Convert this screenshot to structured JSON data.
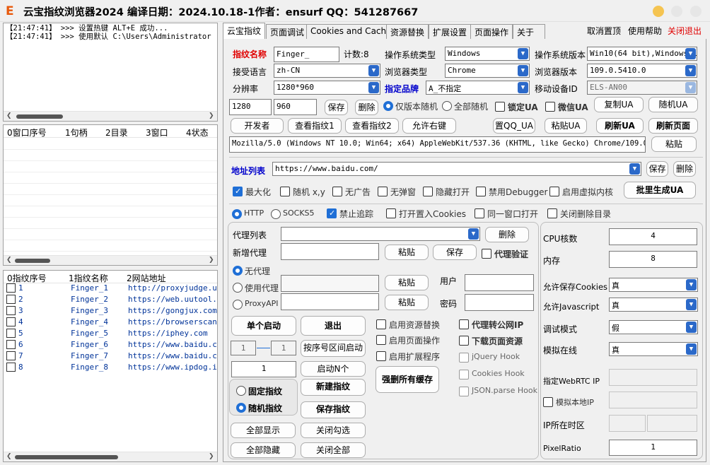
{
  "title": {
    "logo": "E",
    "text": "云宝指纹浏览器2024  编译日期：2024.10.18-1作者：ensurf  QQ：541287667"
  },
  "log": {
    "lines": [
      "【21:47:41】 >>> 设置热键 ALT+E 成功...",
      "【21:47:41】 >>> 使用默认 C:\\Users\\Administrator"
    ]
  },
  "windows_list": {
    "headers": [
      "0窗口序号",
      "1句柄",
      "2目录",
      "3窗口",
      "4状态"
    ]
  },
  "fingerprint_list": {
    "headers": [
      "0指纹序号",
      "1指纹名称",
      "2网站地址"
    ],
    "rows": [
      {
        "id": "1",
        "name": "Finger_1",
        "url": "http://proxyjudge.us"
      },
      {
        "id": "2",
        "name": "Finger_2",
        "url": "https://web.uutool.cn"
      },
      {
        "id": "3",
        "name": "Finger_3",
        "url": "https://gongjux.com/f"
      },
      {
        "id": "4",
        "name": "Finger_4",
        "url": "https://browserscan.n"
      },
      {
        "id": "5",
        "name": "Finger_5",
        "url": "https://iphey.com"
      },
      {
        "id": "6",
        "name": "Finger_6",
        "url": "https://www.baidu.com"
      },
      {
        "id": "7",
        "name": "Finger_7",
        "url": "https://www.baidu.com"
      },
      {
        "id": "8",
        "name": "Finger_8",
        "url": "https://www.ipdog.io/"
      }
    ]
  },
  "tabs": [
    "云宝指纹",
    "页面调试",
    "Cookies and Cache",
    "资源替换",
    "扩展设置",
    "页面操作",
    "关于"
  ],
  "menu": {
    "cancel_top": "取消置顶",
    "help": "使用帮助",
    "close_exit": "关闭退出"
  },
  "fp": {
    "name_label": "指纹名称",
    "name_value": "Finger_",
    "count": "计数:8",
    "os_type_label": "操作系统类型",
    "os_type": "Windows",
    "os_ver_label": "操作系统版本",
    "os_ver": "Win10(64 bit),Windows 1",
    "lang_label": "接受语言",
    "lang": "zh-CN",
    "browser_type_label": "浏览器类型",
    "browser_type": "Chrome",
    "browser_ver_label": "浏览器版本",
    "browser_ver": "109.0.5410.0",
    "res_label": "分辨率",
    "res": "1280*960",
    "brand_label": "指定品牌",
    "brand": "A_不指定",
    "mobile_label": "移动设备ID",
    "mobile": "ELS-AN00",
    "w": "1280",
    "h": "960",
    "save": "保存",
    "delete": "删除",
    "only_ver_random": "仅版本随机",
    "all_random": "全部随机",
    "lock_ua": "锁定UA",
    "wechat_ua": "微信UA",
    "copy_ua": "复制UA",
    "random_ua": "随机UA",
    "devtools": "开发者",
    "view_fp1": "查看指纹1",
    "view_fp2": "查看指纹2",
    "allow_right": "允许右键",
    "qq_ua": "置QQ_UA",
    "paste_ua": "粘贴UA",
    "refresh_ua": "刷新UA",
    "refresh_page": "刷新页面",
    "ua_string": "Mozilla/5.0 (Windows NT 10.0; Win64; x64) AppleWebKit/537.36 (KHTML, like Gecko) Chrome/109.0.5410",
    "paste": "粘贴",
    "addr_label": "地址列表",
    "addr": "https://www.baidu.com/",
    "addr_save": "保存",
    "addr_delete": "删除",
    "maximize": "最大化",
    "random_xy": "随机 x,y",
    "no_ads": "无广告",
    "no_popup": "无弹窗",
    "hidden_open": "隐藏打开",
    "disable_debugger": "禁用Debugger",
    "virtual_core": "启用虚拟内核",
    "batch_ua": "批里生成UA"
  },
  "proxy": {
    "http": "HTTP",
    "socks5": "SOCKS5",
    "no_track": "禁止追踪",
    "open_cookies": "打开置入Cookies",
    "same_window": "同一窗口打开",
    "close_delete": "关闭删除目录",
    "list_label": "代理列表",
    "list_delete": "删除",
    "add_label": "新增代理",
    "paste": "粘贴",
    "save": "保存",
    "verify": "代理验证",
    "none": "无代理",
    "use": "使用代理",
    "api": "ProxyAPI",
    "user": "用户",
    "pwd": "密码"
  },
  "ops": {
    "single_start": "单个启动",
    "exit": "退出",
    "range_from": "1",
    "range_to": "1",
    "range_start": "按序号区间启动",
    "n": "1",
    "start_n": "启动N个",
    "fixed": "固定指纹",
    "random": "随机指纹",
    "new_fp": "新建指纹",
    "save_fp": "保存指纹",
    "show_all": "全部显示",
    "close_checked": "关闭勾选",
    "hide_all": "全部隐藏",
    "close_all": "关闭全部",
    "res_replace": "启用资源替换",
    "page_op": "启用页面操作",
    "ext": "启用扩展程序",
    "clear_cache": "强删所有缓存",
    "proxy_public": "代理转公网IP",
    "download_res": "下载页面资源",
    "jquery": "jQuery Hook",
    "cookies_hook": "Cookies Hook",
    "json_hook": "JSON.parse Hook"
  },
  "hw": {
    "cpu_label": "CPU核数",
    "cpu": "4",
    "mem_label": "内存",
    "mem": "8",
    "save_cookies_label": "允许保存Cookies",
    "save_cookies": "真",
    "js_label": "允许Javascript",
    "js": "真",
    "debug_label": "调试模式",
    "debug": "假",
    "mobile_sim_label": "模拟在线",
    "mobile_sim": "真",
    "webrtc_label": "指定WebRTC IP",
    "local_ip": "模拟本地IP",
    "tz_label": "IP所在时区",
    "pixel_label": "PixelRatio",
    "pixel": "1"
  }
}
